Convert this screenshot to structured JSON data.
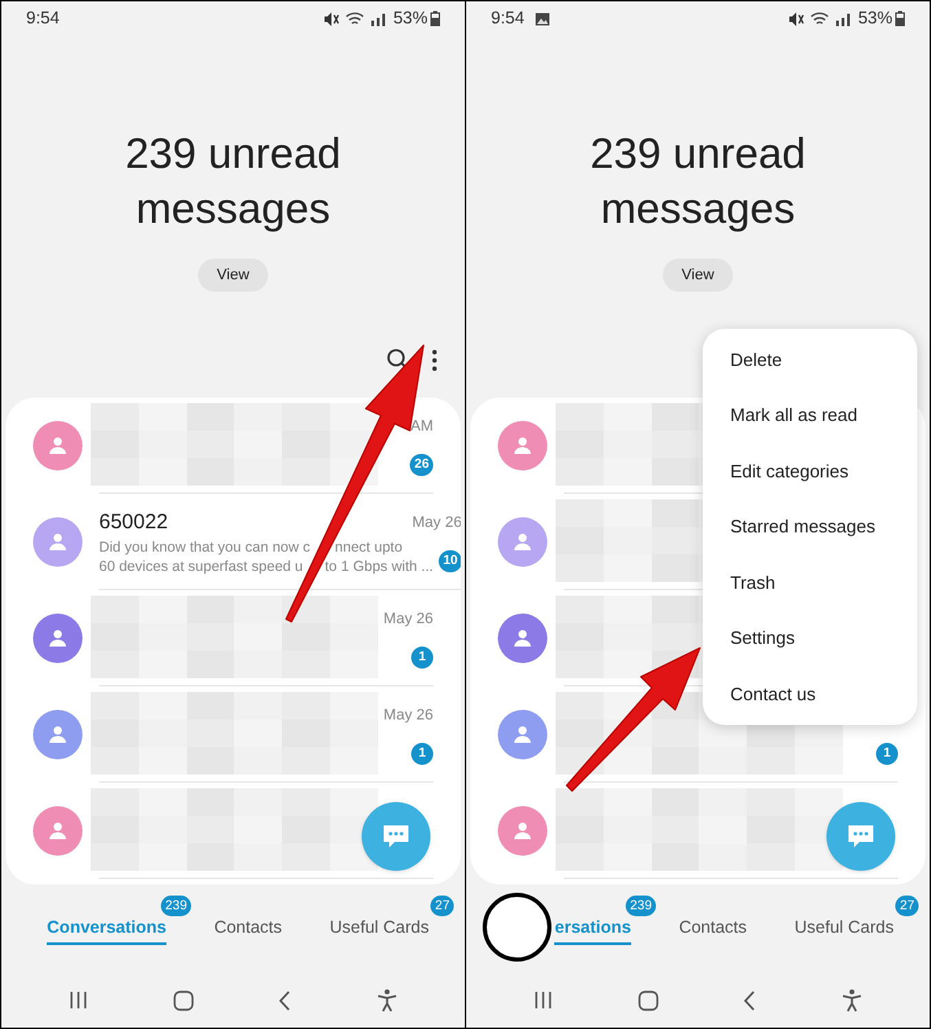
{
  "screens": [
    {
      "status_bar": {
        "time": "9:54",
        "battery": "53%"
      },
      "headline": "239 unread messages",
      "view_button": "View",
      "menu_open": false,
      "annotation": {
        "kind": "arrow_to_more_button"
      },
      "messages": [
        {
          "color": "#f08db4",
          "redacted": true,
          "time": "AM",
          "badge": "26"
        },
        {
          "color": "#b7a6f2",
          "redacted": false,
          "name": "650022",
          "time": "May 26",
          "snippet_lines": [
            [
              "Did you know that you can now c",
              "nnect upto"
            ],
            [
              "60 devices at superfast speed u",
              "to 1 Gbps with ..."
            ]
          ],
          "badge": "10"
        },
        {
          "color": "#8c7ae6",
          "redacted": true,
          "time": "May 26",
          "badge": "1"
        },
        {
          "color": "#8f9df0",
          "redacted": true,
          "time": "May 26",
          "badge": "1"
        },
        {
          "color": "#f08db4",
          "redacted": true
        }
      ],
      "tabs": [
        {
          "label": "Conversations",
          "badge": "239",
          "selected": true
        },
        {
          "label": "Contacts",
          "selected": false
        },
        {
          "label": "Useful Cards",
          "badge": "27",
          "selected": false
        }
      ]
    },
    {
      "status_bar": {
        "time": "9:54",
        "gallery_notification": true,
        "battery": "53%"
      },
      "headline": "239 unread messages",
      "view_button": "View",
      "menu_open": true,
      "annotation": {
        "kind": "arrow_to_settings"
      },
      "touch_indicator": true,
      "menu": [
        "Delete",
        "Mark all as read",
        "Edit categories",
        "Starred messages",
        "Trash",
        "Settings",
        "Contact us"
      ],
      "messages": [
        {
          "color": "#f08db4",
          "redacted": true
        },
        {
          "color": "#b7a6f2",
          "redacted": true
        },
        {
          "color": "#8c7ae6",
          "redacted": true
        },
        {
          "color": "#8f9df0",
          "redacted": true,
          "badge": "1"
        },
        {
          "color": "#f08db4",
          "redacted": true
        }
      ],
      "tabs": [
        {
          "label": "ersations",
          "badge": "239",
          "selected": true
        },
        {
          "label": "Contacts",
          "selected": false
        },
        {
          "label": "Useful Cards",
          "badge": "27",
          "selected": false
        }
      ]
    }
  ]
}
